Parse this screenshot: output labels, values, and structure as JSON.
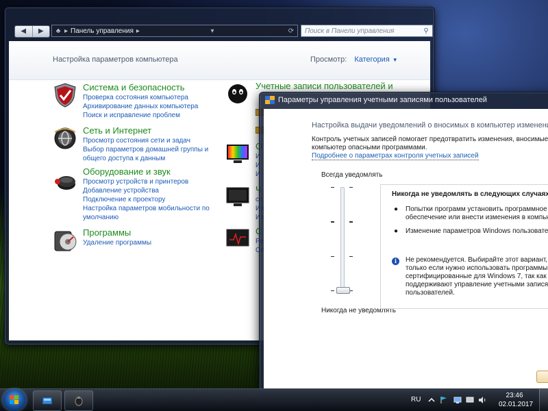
{
  "control_panel": {
    "address_path": "Панель управления",
    "search_placeholder": "Поиск в Панели управления",
    "header_title": "Настройка параметров компьютера",
    "view_label": "Просмотр:",
    "view_value": "Категория",
    "categories": [
      {
        "title": "Система и безопасность",
        "icon": "shield-icon",
        "links": [
          "Проверка состояния компьютера",
          "Архивирование данных компьютера",
          "Поиск и исправление проблем"
        ]
      },
      {
        "title": "Сеть и Интернет",
        "icon": "globe-icon",
        "links": [
          "Просмотр состояния сети и задач",
          "Выбор параметров домашней группы и",
          "общего доступа к данным"
        ]
      },
      {
        "title": "Оборудование и звук",
        "icon": "speaker-mouse-icon",
        "links": [
          "Просмотр устройств и принтеров",
          "Добавление устройства",
          "Подключение к проектору",
          "Настройка параметров мобильности по",
          "умолчанию"
        ]
      },
      {
        "title": "Программы",
        "icon": "programs-disc-icon",
        "links": [
          "Удаление программы"
        ]
      },
      {
        "title": "Учетные записи пользователей и",
        "icon": "user-account-icon",
        "links": []
      }
    ],
    "right_partial": [
      {
        "title": "О",
        "links": [
          "И",
          "И",
          "И"
        ]
      },
      {
        "title": "Ч",
        "links": [
          "сп",
          "Из",
          "Из"
        ]
      },
      {
        "title": "С",
        "links": [
          "Ре",
          "Оп"
        ]
      }
    ]
  },
  "uac": {
    "title": "Параметры управления учетными записями пользователей",
    "heading": "Настройка выдачи уведомлений о вносимых в компьютер изменениях",
    "description": "Контроль учетных записей помогает предотвратить изменения, вносимые в компьютер опасными программами.",
    "link": "Подробнее о параметрах контроля учетных записей",
    "slider_top_label": "Всегда уведомлять",
    "slider_bottom_label": "Никогда не уведомлять",
    "slider_level": 0,
    "info_heading": "Никогда не уведомлять в следующих случаях:",
    "bullets": [
      "Попытки программ установить программное обеспечение или внести изменения в компьютер",
      "Изменение параметров Windows пользователем"
    ],
    "note": "Не рекомендуется. Выбирайте этот вариант, только если нужно использовать программы, не сертифицированные для Windows 7, так как они не поддерживают управление учетными записями пользователей."
  },
  "taskbar": {
    "lang": "RU",
    "time": "23:46",
    "date": "02.01.2017",
    "tray_icons": [
      "flag-icon",
      "network-icon",
      "monitor-icon",
      "volume-icon"
    ]
  },
  "colors": {
    "link": "#1c5bb6",
    "category_title": "#1e8a1e"
  }
}
